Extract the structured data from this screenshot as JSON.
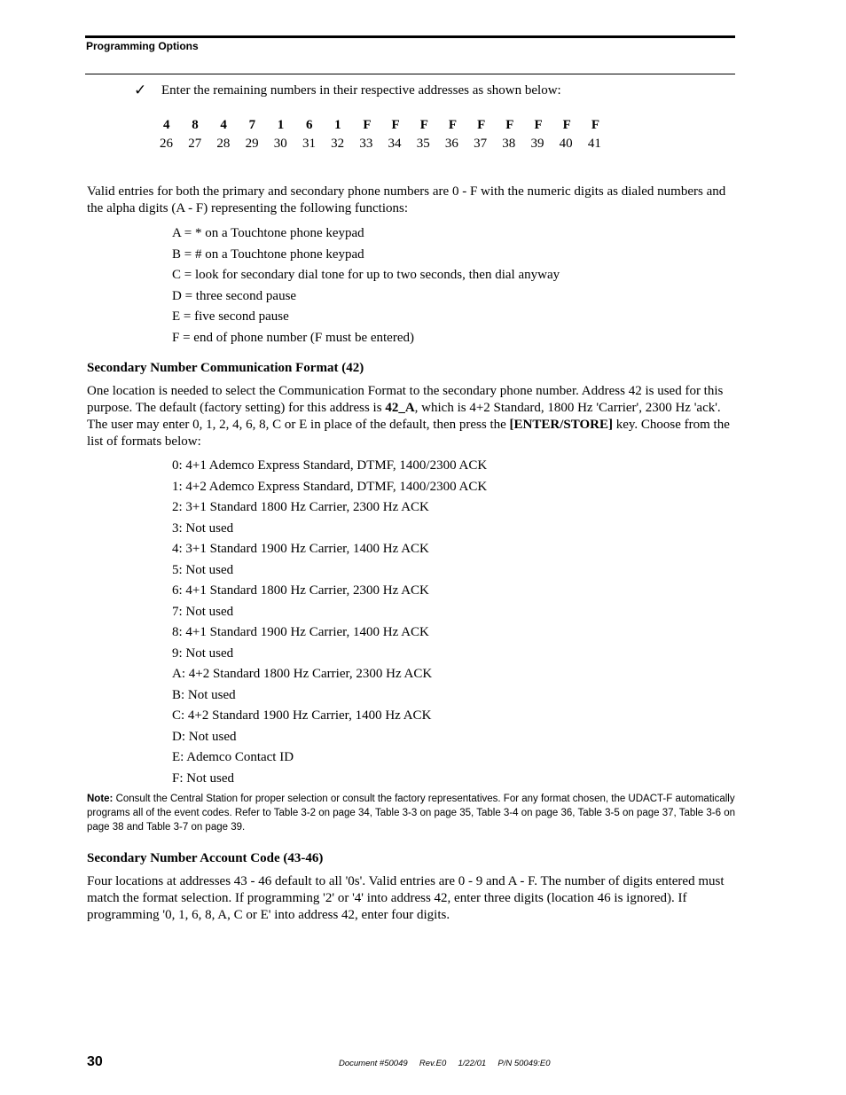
{
  "header": {
    "section_title": "Programming Options"
  },
  "instruction": {
    "icon": "checkmark-icon",
    "icon_glyph": "✓",
    "text": "Enter the remaining numbers in their respective addresses as shown below:"
  },
  "address_table": {
    "values": [
      "4",
      "8",
      "4",
      "7",
      "1",
      "6",
      "1",
      "F",
      "F",
      "F",
      "F",
      "F",
      "F",
      "F",
      "F",
      "F"
    ],
    "addresses": [
      "26",
      "27",
      "28",
      "29",
      "30",
      "31",
      "32",
      "33",
      "34",
      "35",
      "36",
      "37",
      "38",
      "39",
      "40",
      "41"
    ]
  },
  "valid_entries": {
    "text": "Valid entries for both the primary and secondary phone numbers are 0 - F with the numeric digits as dialed numbers and the alpha digits (A - F) representing the following functions:",
    "functions": [
      "A = * on a Touchtone phone keypad",
      "B = # on a Touchtone phone keypad",
      "C = look for secondary dial tone for up to two seconds, then dial anyway",
      "D = three second pause",
      "E = five second pause",
      "F = end of phone number (F must be entered)"
    ]
  },
  "format_section": {
    "heading": "Secondary Number Communication Format (42)",
    "para_part1": "One location is needed to select the Communication Format to the secondary phone number.  Address 42 is used for this purpose.  The default (factory setting) for this address is ",
    "para_bold1": "42_A",
    "para_part2": ", which is 4+2 Standard, 1800 Hz 'Carrier', 2300 Hz 'ack'.  The user may enter 0, 1, 2, 4, 6, 8, C or E in place of the default, then press the ",
    "para_bold2": "[ENTER/STORE]",
    "para_part3": " key.  Choose from the list of formats below:",
    "formats": [
      "0: 4+1 Ademco Express Standard, DTMF, 1400/2300 ACK",
      "1: 4+2 Ademco Express Standard, DTMF, 1400/2300 ACK",
      "2: 3+1 Standard 1800 Hz Carrier, 2300 Hz ACK",
      "3: Not used",
      "4: 3+1 Standard 1900 Hz Carrier, 1400 Hz ACK",
      "5: Not used",
      "6: 4+1 Standard 1800 Hz Carrier, 2300 Hz ACK",
      "7: Not used",
      "8: 4+1 Standard 1900 Hz Carrier, 1400 Hz ACK",
      "9: Not used",
      "A: 4+2 Standard 1800 Hz Carrier, 2300 Hz ACK",
      "B: Not used",
      "C: 4+2 Standard 1900 Hz Carrier, 1400 Hz ACK",
      "D: Not used",
      "E: Ademco Contact ID",
      "F: Not used"
    ]
  },
  "note": {
    "label": "Note:",
    "text": " Consult the Central Station for proper selection or consult the factory representatives.  For any format chosen, the UDACT-F automatically programs all of the event codes.  Refer to Table 3-2 on page 34, Table 3-3 on page 35, Table 3-4 on page 36, Table 3-5 on page 37, Table 3-6 on page 38 and Table 3-7 on page 39."
  },
  "account_section": {
    "heading": "Secondary Number Account Code (43-46)",
    "text": "Four locations at addresses 43 - 46 default to all '0s'.  Valid entries are 0 - 9 and A - F.  The number of digits entered must match the format selection.  If programming '2' or '4' into address 42, enter three digits (location 46 is ignored).  If programming '0, 1, 6, 8, A, C or E' into address 42, enter four digits."
  },
  "footer": {
    "page_number": "30",
    "document": "Document #50049     Rev.E0     1/22/01     P/N 50049:E0"
  }
}
